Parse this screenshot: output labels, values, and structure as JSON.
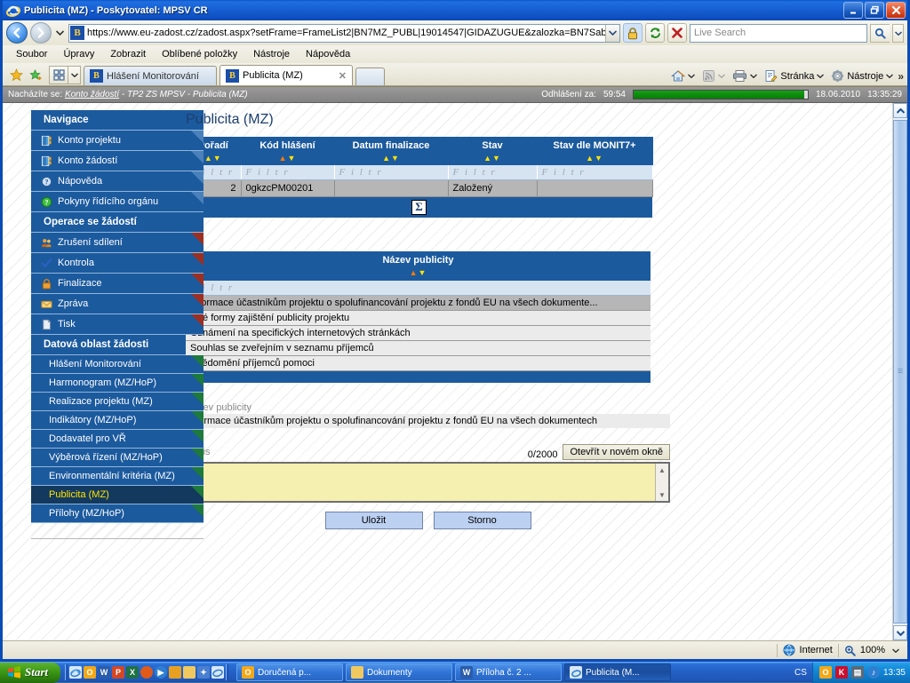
{
  "window": {
    "title": "Publicita (MZ) - Poskytovatel: MPSV CR",
    "minimize_label": "_",
    "restore_label": "❐",
    "close_label": "✕"
  },
  "browser": {
    "url": "https://www.eu-zadost.cz/zadost.aspx?setFrame=FrameList2|BN7MZ_PUBL|19014547|GIDAZUGUE&zalozka=BN7Sab",
    "favicon_letter": "B",
    "search_placeholder": "Live Search",
    "menu": [
      "Soubor",
      "Úpravy",
      "Zobrazit",
      "Oblíbené položky",
      "Nástroje",
      "Nápověda"
    ],
    "tabs": [
      {
        "label": "Hlášení Monitorování",
        "active": false
      },
      {
        "label": "Publicita (MZ)",
        "active": true,
        "close_label": "✕"
      }
    ],
    "toolbar_right": [
      {
        "label": "Stránka",
        "icon": "page-icon"
      },
      {
        "label": "Nástroje",
        "icon": "gear-icon"
      }
    ],
    "overflow_label": "»"
  },
  "statusbar": {
    "zone": "Internet",
    "zoom": "100%"
  },
  "infobar": {
    "prefix": "Nacházíte se:",
    "crumb_link": "Konto žádostí",
    "crumb_rest": " - TP2 ZS MPSV - Publicita (MZ)",
    "logout_label": "Odhlášení za:",
    "logout_time": "59:54",
    "progress_percent": 98,
    "date": "18.06.2010",
    "time": "13:35:29"
  },
  "sidebar": {
    "groups": [
      {
        "header": "Navigace",
        "items": [
          {
            "label": "Konto projektu",
            "icon": "book-icon",
            "flag": "white",
            "indent": false,
            "selected": false
          },
          {
            "label": "Konto žádostí",
            "icon": "book-icon",
            "flag": "white",
            "indent": false,
            "selected": false
          },
          {
            "label": "Nápověda",
            "icon": "help-blue-icon",
            "flag": "white",
            "indent": false,
            "selected": false
          },
          {
            "label": "Pokyny řídícího orgánu",
            "icon": "help-green-icon",
            "flag": "white",
            "indent": false,
            "selected": false
          }
        ]
      },
      {
        "header": "Operace se žádostí",
        "items": [
          {
            "label": "Zrušení sdílení",
            "icon": "users-icon",
            "flag": "red",
            "indent": false,
            "selected": false
          },
          {
            "label": "Kontrola",
            "icon": "check-icon",
            "flag": "red",
            "indent": false,
            "selected": false
          },
          {
            "label": "Finalizace",
            "icon": "lock-icon",
            "flag": "red",
            "indent": false,
            "selected": false
          },
          {
            "label": "Zpráva",
            "icon": "envelope-icon",
            "flag": "red",
            "indent": false,
            "selected": false
          },
          {
            "label": "Tisk",
            "icon": "document-icon",
            "flag": "red",
            "indent": false,
            "selected": false
          }
        ]
      },
      {
        "header": "Datová oblast žádosti",
        "items": [
          {
            "label": "Hlášení Monitorování",
            "icon": "",
            "flag": "green",
            "indent": true,
            "selected": false
          },
          {
            "label": "Harmonogram (MZ/HoP)",
            "icon": "",
            "flag": "green",
            "indent": true,
            "selected": false
          },
          {
            "label": "Realizace projektu (MZ)",
            "icon": "",
            "flag": "green",
            "indent": true,
            "selected": false
          },
          {
            "label": "Indikátory (MZ/HoP)",
            "icon": "",
            "flag": "green",
            "indent": true,
            "selected": false
          },
          {
            "label": "Dodavatel pro VŘ",
            "icon": "",
            "flag": "green",
            "indent": true,
            "selected": false
          },
          {
            "label": "Výběrová řízení (MZ/HoP)",
            "icon": "",
            "flag": "green",
            "indent": true,
            "selected": false
          },
          {
            "label": "Environmentální kritéria (MZ)",
            "icon": "",
            "flag": "green",
            "indent": true,
            "selected": false
          },
          {
            "label": "Publicita (MZ)",
            "icon": "",
            "flag": "green",
            "indent": true,
            "selected": true
          },
          {
            "label": "Přílohy (MZ/HoP)",
            "icon": "",
            "flag": "green",
            "indent": true,
            "selected": false
          }
        ]
      }
    ]
  },
  "main": {
    "title": "Publicita (MZ)",
    "reports_table": {
      "columns": [
        {
          "label": "Pořadí",
          "sort": "none"
        },
        {
          "label": "Kód hlášení",
          "sort": "asc"
        },
        {
          "label": "Datum finalizace",
          "sort": "none"
        },
        {
          "label": "Stav",
          "sort": "none"
        },
        {
          "label": "Stav dle MONIT7+",
          "sort": "none"
        }
      ],
      "filter_placeholder": "F i l t r",
      "rows": [
        {
          "poradi": "2",
          "kod": "0gkzcPM00201",
          "datum": "",
          "stav": "Založený",
          "monit": ""
        }
      ],
      "sum_icon": "Σ"
    },
    "publicity_table": {
      "header": "Název publicity",
      "sort": "asc",
      "filter_placeholder": "F i l t r",
      "rows": [
        {
          "label": "Informace účastníkům projektu o spolufinancování projektu z fondů EU na všech dokumente...",
          "selected": true
        },
        {
          "label": "Jiné formy zajištění publicity projektu",
          "selected": false
        },
        {
          "label": "Oznámení na specifických internetových stránkách",
          "selected": false
        },
        {
          "label": "Souhlas se zveřejním v seznamu příjemců",
          "selected": false
        },
        {
          "label": "Uvědomění příjemců pomoci",
          "selected": false
        }
      ]
    },
    "detail": {
      "name_label": "Název publicity",
      "name_value": "Informace účastníkům projektu o spolufinancování projektu z fondů EU na všech dokumentech",
      "popis_label": "Popis",
      "popis_value": "",
      "counter": "0/2000",
      "open_window_label": "Otevřít v novém okně",
      "save_label": "Uložit",
      "cancel_label": "Storno"
    }
  },
  "taskbar": {
    "start_label": "Start",
    "tasks": [
      {
        "label": "Doručená p...",
        "icon": "outlook-icon",
        "active": false
      },
      {
        "label": "Dokumenty",
        "icon": "folder-icon",
        "active": false
      },
      {
        "label": "Příloha č. 2 ...",
        "icon": "word-icon",
        "active": false
      },
      {
        "label": "Publicita (M...",
        "icon": "ie-icon",
        "active": true
      }
    ],
    "language": "CS",
    "clock": "13:35"
  }
}
